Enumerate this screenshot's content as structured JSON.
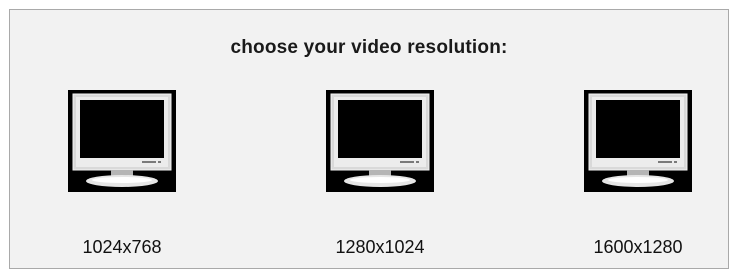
{
  "heading": "choose your video resolution:",
  "options": [
    {
      "label": "1024x768",
      "icon": "monitor-icon"
    },
    {
      "label": "1280x1024",
      "icon": "monitor-icon"
    },
    {
      "label": "1600x1280",
      "icon": "monitor-icon"
    }
  ],
  "colors": {
    "panel_background": "#f2f2f2",
    "panel_border": "#a9a9a9",
    "screen": "#000000"
  }
}
